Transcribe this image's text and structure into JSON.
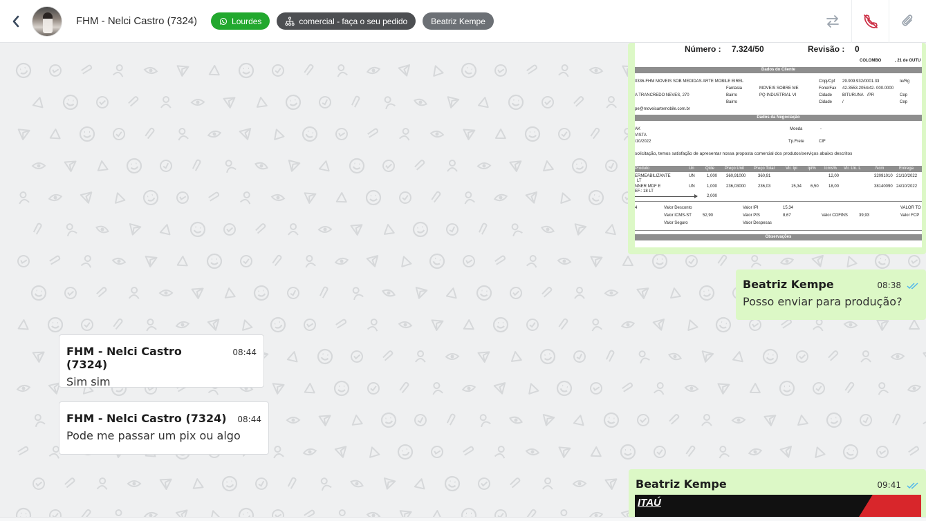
{
  "header": {
    "contact_name": "FHM - Nelci Castro (7324)",
    "tags": [
      {
        "label": "Lourdes",
        "icon": "whatsapp-icon",
        "color": "#22a82e"
      },
      {
        "label": "comercial - faça o seu pedido",
        "icon": "sitemap-icon",
        "color": "#4d4f52"
      },
      {
        "label": "Beatriz Kempe",
        "color": "#6c7075"
      }
    ],
    "actions": [
      "transfer-icon",
      "end-call-icon",
      "attach-icon"
    ]
  },
  "document": {
    "numero_label": "Número :",
    "numero_value": "7.324/50",
    "revisao_label": "Revisão :",
    "revisao_value": "0",
    "city": "COLOMBO",
    "date": ", 21 de OUTU",
    "sec_cliente": "Dados do Cliente",
    "cliente_name": "0336-FHM MOVEIS SOB MEDIDAS ARTE MOBILE EIREL",
    "cnpj_label": "Cnpj/Cpf",
    "cnpj": "29.909.932/0001.33",
    "ie_label": "Ie/Rg",
    "fantasia_label": "Fantasia",
    "fantasia": "MOVEIS SOBRE ME",
    "fone_label": "Fone/Fax",
    "fone": "42-3553.2054/42- 000.0000",
    "endereco": "A TRANCREDO NEVES, 270",
    "bairro_label": "Bairro",
    "bairro": "PQ INDUSTRIAL VI",
    "cidade_label": "Cidade",
    "cidade": "BITURUNA",
    "uf": "/PR",
    "cep_label": "Cep",
    "bairro2_label": "Bairro",
    "cidade2_label": "Cidade",
    "cidade2": "/",
    "cep2_label": "Cep",
    "email": "pe@moveisartemobile.com.br",
    "sec_negociacao": "Dados da Negociação",
    "neg1": "AK",
    "moeda_label": "Moeda",
    "moeda": "-",
    "neg2": "VISTA",
    "neg3": "/10/2022",
    "frete_label": "Tp.Frete",
    "frete": "CIF",
    "intro": "solicitação, temos satisfação de apresentar nossa proposta comercial dos produtos/serviços abaixo descritos",
    "cols": [
      "Produto",
      "Un",
      "Qtde",
      "Preço Unit",
      "Preço Total",
      "Vlr. Ipi",
      "Ipi%",
      "Icms%",
      "Vlr. Un. L",
      "Ncm",
      "Entrega"
    ],
    "items": [
      {
        "produto": "ERMEABILIZANTE",
        "produto2": "LT",
        "un": "UN",
        "qtde": "1,000",
        "unit": "360,91000",
        "total": "360,91",
        "ipi": "",
        "ipip": "",
        "icms": "12,00",
        "ncm": "32091010",
        "entrega": "21/10/2022"
      },
      {
        "produto": "NNER MDF E",
        "produto2": "EF.: 18 LT",
        "un": "UN",
        "qtde": "1,000",
        "unit": "236,03000",
        "total": "236,03",
        "ipi": "15,34",
        "ipip": "6,50",
        "icms": "18,00",
        "ncm": "38140090",
        "entrega": "24/10/2022"
      }
    ],
    "qtde_total": "2,000",
    "tot_idx": "4",
    "valor_desconto_label": "Valor Desconto",
    "valor_ipi_label": "Valor IPI",
    "valor_ipi": "15,34",
    "valor_tot_label": "VALOR TO",
    "valor_icmsst_label": "Valor ICMS-ST",
    "valor_icmsst": "52,90",
    "valor_pis_label": "Valor PIS",
    "valor_pis": "8,67",
    "valor_cofins_label": "Valor COFINS",
    "valor_cofins": "39,93",
    "valor_fcp_label": "Valor FCP",
    "valor_seguro_label": "Valor Seguro",
    "valor_despesas_label": "Valor Despesas",
    "sec_obs": "Observações"
  },
  "messages": [
    {
      "sender": "Beatriz Kempe",
      "time": "08:38",
      "text": "Posso enviar para produção?",
      "direction": "out"
    },
    {
      "sender": "FHM - Nelci Castro (7324)",
      "time": "08:44",
      "text": "Sim sim",
      "direction": "in"
    },
    {
      "sender": "FHM - Nelci Castro (7324)",
      "time": "08:44",
      "text": "Pode me passar um pix ou algo",
      "direction": "in"
    },
    {
      "sender": "Beatriz Kempe",
      "time": "09:41",
      "image_label": "ITAÚ",
      "direction": "out"
    }
  ],
  "colors": {
    "outgoing": "#dcf8c6",
    "incoming": "#ffffff",
    "read_ticks": "#4fb6ec",
    "accent_green": "#22a82e"
  }
}
